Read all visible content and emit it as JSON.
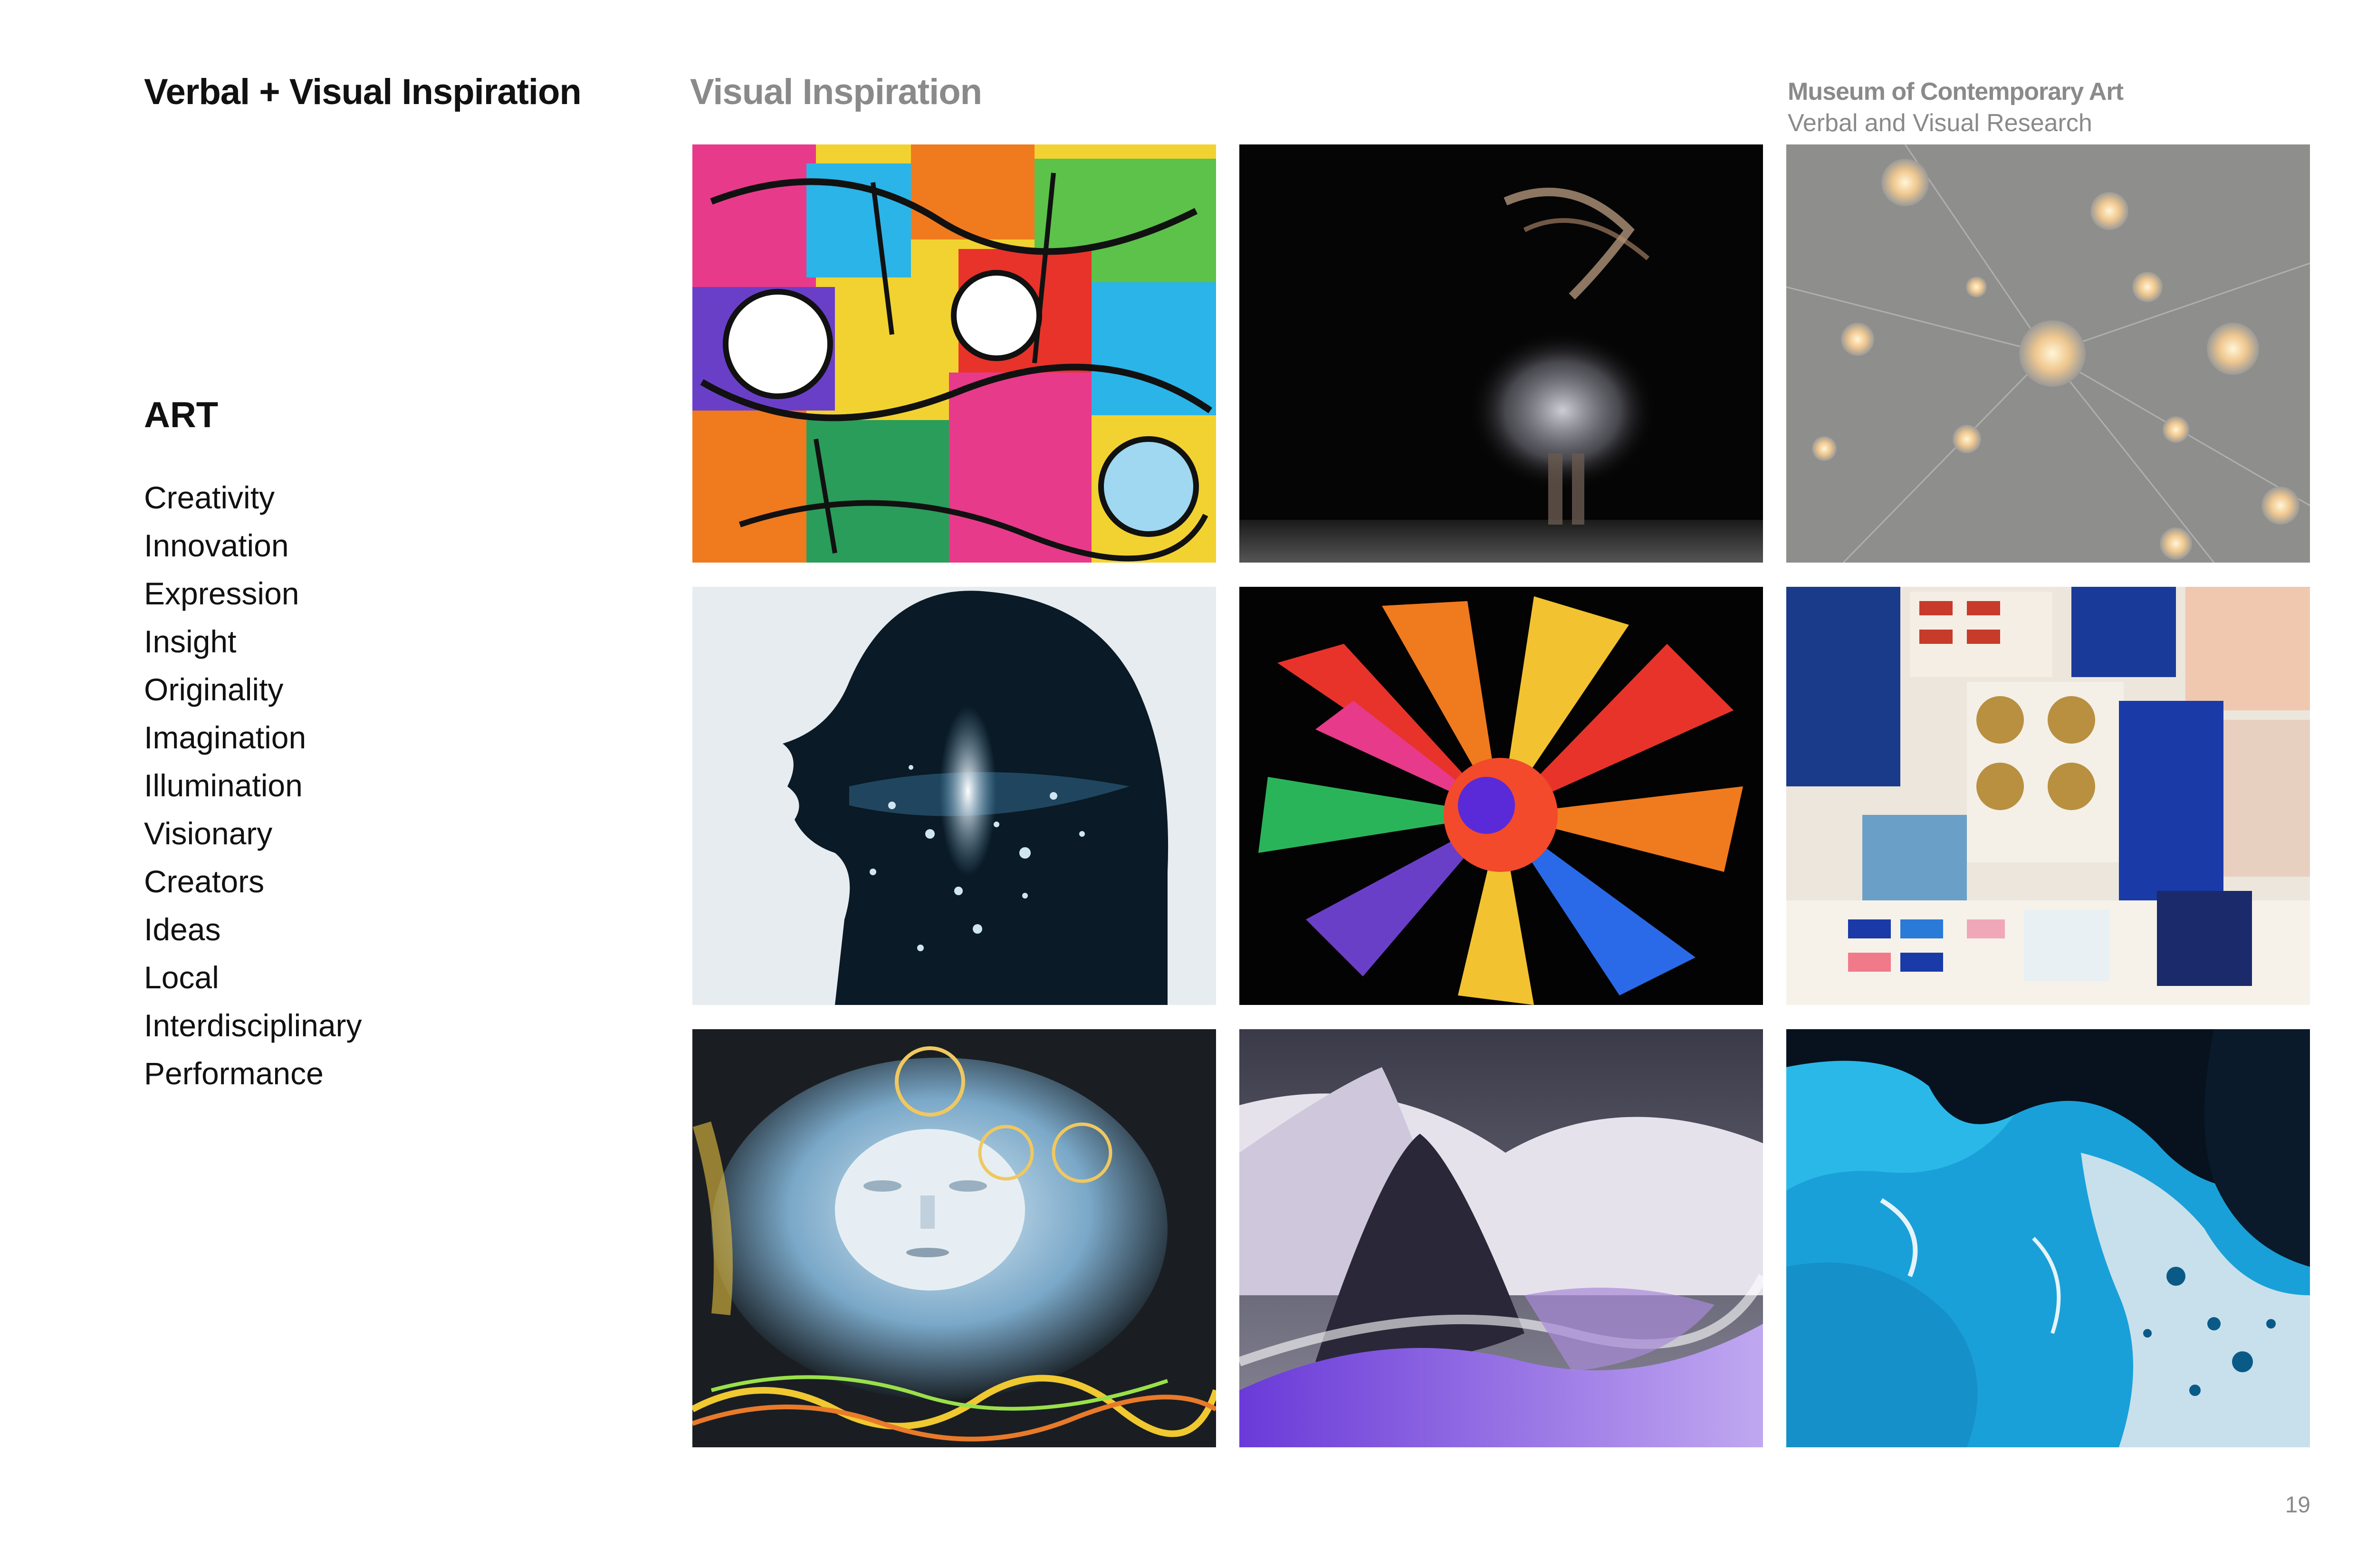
{
  "header": {
    "doc_title": "Verbal + Visual Inspiration",
    "section_title": "Visual Inspiration",
    "org_name": "Museum of Contemporary Art",
    "org_subtitle": "Verbal and Visual Research"
  },
  "category": {
    "heading": "ART",
    "keywords": [
      "Creativity",
      "Innovation",
      "Expression",
      "Insight",
      "Originality",
      "Imagination",
      "Illumination",
      "Visionary",
      "Creators",
      "Ideas",
      "Local",
      "Interdisciplinary",
      "Performance"
    ]
  },
  "gallery": {
    "images": [
      {
        "name": "colorful-doodle-mural-image"
      },
      {
        "name": "motion-blur-dancer-image"
      },
      {
        "name": "hanging-glass-orbs-image"
      },
      {
        "name": "starry-silhouette-profile-image"
      },
      {
        "name": "color-powder-explosion-image"
      },
      {
        "name": "abstract-collage-moodboard-image"
      },
      {
        "name": "dreamlike-face-clouds-image"
      },
      {
        "name": "flowing-fabric-performance-image"
      },
      {
        "name": "blue-fluid-art-image"
      }
    ]
  },
  "footer": {
    "page_number": "19"
  },
  "colors": {
    "title": "#111111",
    "muted": "#8a8a8a",
    "background": "#ffffff"
  }
}
